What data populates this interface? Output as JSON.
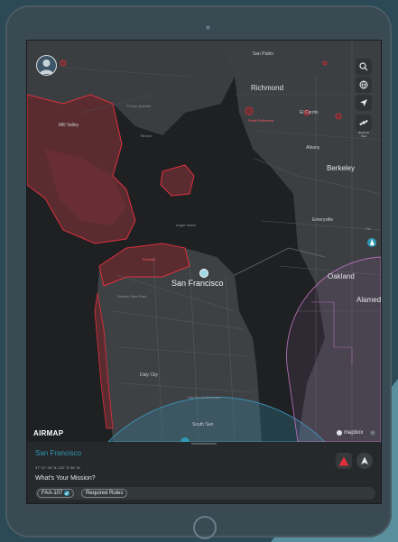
{
  "map": {
    "labels": {
      "san_francisco": "San Francisco",
      "oakland": "Oakland",
      "berkeley": "Berkeley",
      "richmond": "Richmond",
      "emeryville": "Emeryville",
      "alameda": "Alamed",
      "albany": "Albany",
      "el_cerrito": "El Cerrito",
      "mill_valley": "Mill Valley",
      "san_pablo": "San Pablo",
      "tiburon": "Tiburon",
      "daly_city": "Daly City",
      "south_san": "South San",
      "presidio": "Presidio",
      "angel_island": "Angel Island",
      "golden_gate_park": "Golden Gate Park",
      "san_bruno_mountain": "San Bruno Mountain",
      "regional_park": "Regional Park",
      "piedmont": "Pie",
      "point_richmond": "Point Richmond",
      "pt_san_quentin": "Pt San Quentin"
    },
    "controls": {
      "search_icon": "search-icon",
      "globe_icon": "globe-icon",
      "locate_icon": "locate-arrow-icon",
      "satellite_icon": "satellite-icon",
      "control_caption": "Regional Park"
    },
    "logo": "AIRMAP",
    "attribution": "mapbox",
    "info_symbol": "i",
    "colors": {
      "restricted_red": "#e0303c",
      "circle_blue": "#3b8fb0",
      "circle_purple": "#b06fb3",
      "accent": "#2e99b4"
    }
  },
  "panel": {
    "location_title": "San Francisco",
    "coordinates": "37° 47' 28\" N, 122° 8' 56\" W",
    "mission_label": "What's Your Mission?",
    "chips": [
      {
        "label": "FAA-107",
        "checked": true
      },
      {
        "label": "Required Rules",
        "checked": false
      }
    ],
    "status_warning_icon": "warning-triangle-icon",
    "status_flight_icon": "flight-plane-icon"
  }
}
